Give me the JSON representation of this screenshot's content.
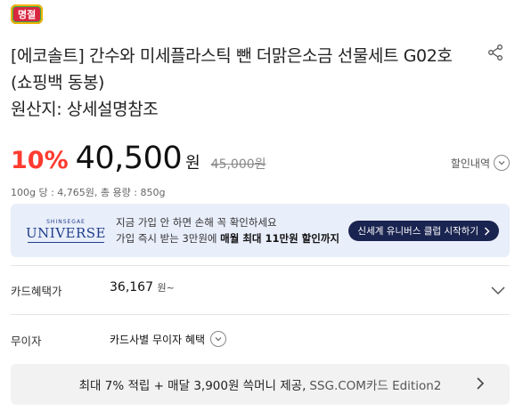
{
  "badge": {
    "label": "명절"
  },
  "product": {
    "title": "[에코솔트] 간수와 미세플라스틱 뺀 더맑은소금 선물세트 G02호 (쇼핑백 동봉)",
    "origin": "원산지: 상세설명참조"
  },
  "price": {
    "discount": "10%",
    "current": "40,500",
    "currency": "원",
    "original": "45,000원",
    "discount_detail_label": "할인내역",
    "unit": "100g 당 : 4,765원, 총 용량 : 850g"
  },
  "banner": {
    "logo_top": "SHINSEGAE",
    "logo_main": "UNIVERSE",
    "line1": "지금 가입 안 하면 손해 꼭 확인하세요",
    "line2_prefix": "가입 즉시 받는 3만원에 ",
    "line2_bold": "매월 최대 11만원 할인까지",
    "button": "신세계 유니버스 클럽 시작하기"
  },
  "card_benefit": {
    "label": "카드혜택가",
    "value": "36,167",
    "suffix": "원~"
  },
  "interest_free": {
    "label": "무이자",
    "value": "카드사별 무이자 혜택"
  },
  "card_info": {
    "main": "최대 7% 적립 + 매달 3,900원 쓱머니 제공,",
    "sub": "SSG.COM카드 Edition2"
  },
  "colors": {
    "discount": "#ff3b30",
    "banner_bg": "#e9eefb",
    "banner_button": "#1a2450"
  }
}
